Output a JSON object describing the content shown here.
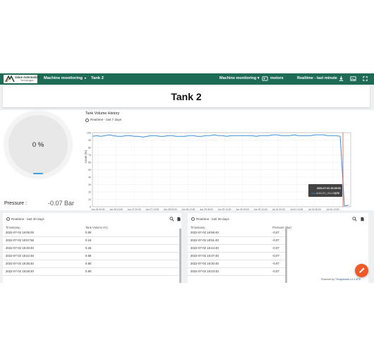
{
  "topbar": {
    "logo_line1": "Value Automation",
    "logo_line2": "Technologies",
    "crumb_parent": "Machine monitoring",
    "crumb_sep": "▸",
    "crumb_current": "Tank 2",
    "state_select": "Machine monitoring ▾",
    "entity_label": "motors",
    "timewindow": "Realtime - last minute"
  },
  "dashboard_title": "Tank 2",
  "gauge": {
    "value": "0 %",
    "level": 0
  },
  "pressure": {
    "label": "Pressure :",
    "value": "-0.07 Bar"
  },
  "chart_widget": {
    "title": "Tank Volume History",
    "timewindow": "Realtime - last 7 days",
    "tooltip_time": "2022-07-02 15:45:00",
    "tooltip_series": "ANALOG_VALUE_0",
    "tooltip_value": "0.76"
  },
  "chart_data": {
    "type": "line",
    "ylabel": "Level (%)",
    "ylim": [
      0,
      100
    ],
    "yticks": [
      "0",
      "10",
      "20",
      "30",
      "40",
      "50",
      "60",
      "70",
      "80",
      "90",
      "100"
    ],
    "xticks": [
      "Jun 26 00:00",
      "Jun 26 12:00",
      "Jun 27 00:00",
      "Jun 27 12:00",
      "Jun 28 00:00",
      "Jun 28 12:00",
      "Jun 29 00:00",
      "Jun 29 12:00",
      "Jun 30 00:00",
      "Jun 30 12:00",
      "Jul 01 00:00",
      "Jul 01 12:00",
      "Jul 02 00:00",
      "Jul 02 12:00"
    ],
    "series": [
      {
        "values": [
          95,
          96,
          95,
          96,
          97,
          96,
          95,
          95,
          96,
          96,
          95,
          95,
          94,
          95,
          96,
          96,
          95,
          95,
          96,
          96,
          95,
          95,
          95,
          96,
          96,
          95,
          95,
          96,
          96,
          97,
          96,
          96,
          95,
          96,
          96,
          96,
          96,
          96,
          96,
          95,
          96,
          96,
          96,
          97,
          97,
          96,
          96,
          96,
          97,
          96,
          96,
          96,
          96,
          97,
          97,
          97,
          96,
          96,
          96,
          95,
          1,
          2
        ]
      }
    ],
    "marker": {
      "label": "2022-07-02 15:45:00"
    }
  },
  "table_left": {
    "title": "Realtime - last 30 days",
    "columns": [
      "Timestamp",
      "Tank Volume (%)"
    ],
    "rows": [
      [
        "2022-07-02 19:05:00",
        "0.80"
      ],
      [
        "2022-07-02 18:57:56",
        "0.16"
      ],
      [
        "2022-07-02 18:49:40",
        "0.26"
      ],
      [
        "2022-07-02 18:42:46",
        "0.66"
      ],
      [
        "2022-07-02 18:35:40",
        "0.90"
      ],
      [
        "2022-07-02 18:28:40",
        "0.80"
      ]
    ]
  },
  "table_right": {
    "title": "Realtime - last 30 days",
    "columns": [
      "Timestamp",
      "Pressure (Bar)"
    ],
    "rows": [
      [
        "2022-07-02 18:58:40",
        "-0.07"
      ],
      [
        "2022-07-02 18:51:40",
        "-0.07"
      ],
      [
        "2022-07-02 18:44:40",
        "-0.07"
      ],
      [
        "2022-07-02 18:37:40",
        "-0.07"
      ],
      [
        "2022-07-02 18:30:40",
        "-0.07"
      ],
      [
        "2022-07-02 18:23:40",
        "-0.07"
      ]
    ]
  },
  "footer": {
    "powered_prefix": "Powered by",
    "powered_brand": "Thingsboard v.3.3.4PE"
  },
  "colors": {
    "topbar": "#1e6b55",
    "series": "#3a8fd6",
    "marker": "#e53935",
    "fab": "#f05a28"
  }
}
